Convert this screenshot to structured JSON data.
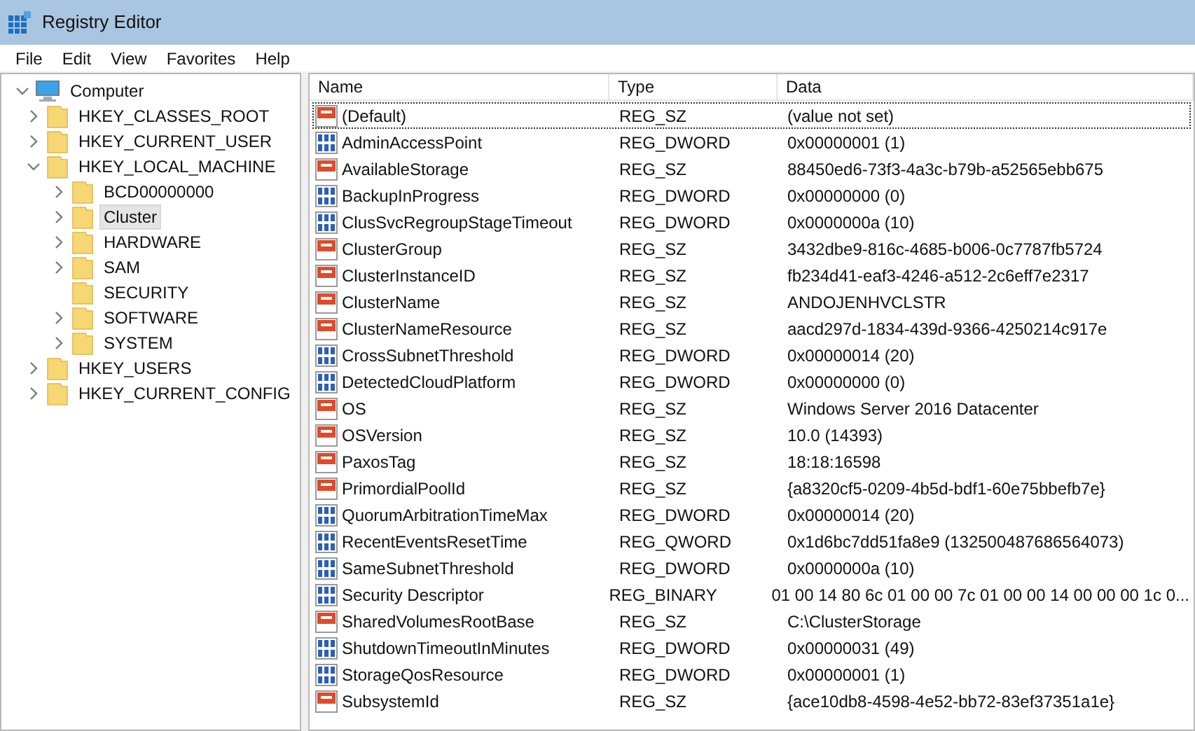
{
  "window": {
    "title": "Registry Editor"
  },
  "menu": [
    "File",
    "Edit",
    "View",
    "Favorites",
    "Help"
  ],
  "tree": [
    {
      "label": "Computer",
      "kind": "computer",
      "expanded": true,
      "expandable": true,
      "selected": false,
      "children": [
        {
          "label": "HKEY_CLASSES_ROOT",
          "kind": "folder",
          "expanded": false,
          "expandable": true,
          "selected": false
        },
        {
          "label": "HKEY_CURRENT_USER",
          "kind": "folder",
          "expanded": false,
          "expandable": true,
          "selected": false
        },
        {
          "label": "HKEY_LOCAL_MACHINE",
          "kind": "folder",
          "expanded": true,
          "expandable": true,
          "selected": false,
          "children": [
            {
              "label": "BCD00000000",
              "kind": "folder",
              "expanded": false,
              "expandable": true,
              "selected": false
            },
            {
              "label": "Cluster",
              "kind": "folder",
              "expanded": false,
              "expandable": true,
              "selected": true
            },
            {
              "label": "HARDWARE",
              "kind": "folder",
              "expanded": false,
              "expandable": true,
              "selected": false
            },
            {
              "label": "SAM",
              "kind": "folder",
              "expanded": false,
              "expandable": true,
              "selected": false
            },
            {
              "label": "SECURITY",
              "kind": "folder",
              "expanded": false,
              "expandable": false,
              "selected": false
            },
            {
              "label": "SOFTWARE",
              "kind": "folder",
              "expanded": false,
              "expandable": true,
              "selected": false
            },
            {
              "label": "SYSTEM",
              "kind": "folder",
              "expanded": false,
              "expandable": true,
              "selected": false
            }
          ]
        },
        {
          "label": "HKEY_USERS",
          "kind": "folder",
          "expanded": false,
          "expandable": true,
          "selected": false
        },
        {
          "label": "HKEY_CURRENT_CONFIG",
          "kind": "folder",
          "expanded": false,
          "expandable": true,
          "selected": false
        }
      ]
    }
  ],
  "table": {
    "columns": [
      "Name",
      "Type",
      "Data"
    ],
    "rows": [
      {
        "kind": "string",
        "name": "(Default)",
        "type": "REG_SZ",
        "data": "(value not set)",
        "focused": true
      },
      {
        "kind": "binary",
        "name": "AdminAccessPoint",
        "type": "REG_DWORD",
        "data": "0x00000001 (1)",
        "focused": false
      },
      {
        "kind": "string",
        "name": "AvailableStorage",
        "type": "REG_SZ",
        "data": "88450ed6-73f3-4a3c-b79b-a52565ebb675",
        "focused": false
      },
      {
        "kind": "binary",
        "name": "BackupInProgress",
        "type": "REG_DWORD",
        "data": "0x00000000 (0)",
        "focused": false
      },
      {
        "kind": "binary",
        "name": "ClusSvcRegroupStageTimeout",
        "type": "REG_DWORD",
        "data": "0x0000000a (10)",
        "focused": false
      },
      {
        "kind": "string",
        "name": "ClusterGroup",
        "type": "REG_SZ",
        "data": "3432dbe9-816c-4685-b006-0c7787fb5724",
        "focused": false
      },
      {
        "kind": "string",
        "name": "ClusterInstanceID",
        "type": "REG_SZ",
        "data": "fb234d41-eaf3-4246-a512-2c6eff7e2317",
        "focused": false
      },
      {
        "kind": "string",
        "name": "ClusterName",
        "type": "REG_SZ",
        "data": "ANDOJENHVCLSTR",
        "focused": false
      },
      {
        "kind": "string",
        "name": "ClusterNameResource",
        "type": "REG_SZ",
        "data": "aacd297d-1834-439d-9366-4250214c917e",
        "focused": false
      },
      {
        "kind": "binary",
        "name": "CrossSubnetThreshold",
        "type": "REG_DWORD",
        "data": "0x00000014 (20)",
        "focused": false
      },
      {
        "kind": "binary",
        "name": "DetectedCloudPlatform",
        "type": "REG_DWORD",
        "data": "0x00000000 (0)",
        "focused": false
      },
      {
        "kind": "string",
        "name": "OS",
        "type": "REG_SZ",
        "data": "Windows Server 2016 Datacenter",
        "focused": false
      },
      {
        "kind": "string",
        "name": "OSVersion",
        "type": "REG_SZ",
        "data": "10.0 (14393)",
        "focused": false
      },
      {
        "kind": "string",
        "name": "PaxosTag",
        "type": "REG_SZ",
        "data": "18:18:16598",
        "focused": false
      },
      {
        "kind": "string",
        "name": "PrimordialPoolId",
        "type": "REG_SZ",
        "data": "{a8320cf5-0209-4b5d-bdf1-60e75bbefb7e}",
        "focused": false
      },
      {
        "kind": "binary",
        "name": "QuorumArbitrationTimeMax",
        "type": "REG_DWORD",
        "data": "0x00000014 (20)",
        "focused": false
      },
      {
        "kind": "binary",
        "name": "RecentEventsResetTime",
        "type": "REG_QWORD",
        "data": "0x1d6bc7dd51fa8e9 (132500487686564073)",
        "focused": false
      },
      {
        "kind": "binary",
        "name": "SameSubnetThreshold",
        "type": "REG_DWORD",
        "data": "0x0000000a (10)",
        "focused": false
      },
      {
        "kind": "binary",
        "name": "Security Descriptor",
        "type": "REG_BINARY",
        "data": "01 00 14 80 6c 01 00 00 7c 01 00 00 14 00 00 00 1c 0...",
        "focused": false
      },
      {
        "kind": "string",
        "name": "SharedVolumesRootBase",
        "type": "REG_SZ",
        "data": "C:\\ClusterStorage",
        "focused": false
      },
      {
        "kind": "binary",
        "name": "ShutdownTimeoutInMinutes",
        "type": "REG_DWORD",
        "data": "0x00000031 (49)",
        "focused": false
      },
      {
        "kind": "binary",
        "name": "StorageQosResource",
        "type": "REG_DWORD",
        "data": "0x00000001 (1)",
        "focused": false
      },
      {
        "kind": "string",
        "name": "SubsystemId",
        "type": "REG_SZ",
        "data": "{ace10db8-4598-4e52-bb72-83ef37351a1e}",
        "focused": false
      }
    ]
  }
}
